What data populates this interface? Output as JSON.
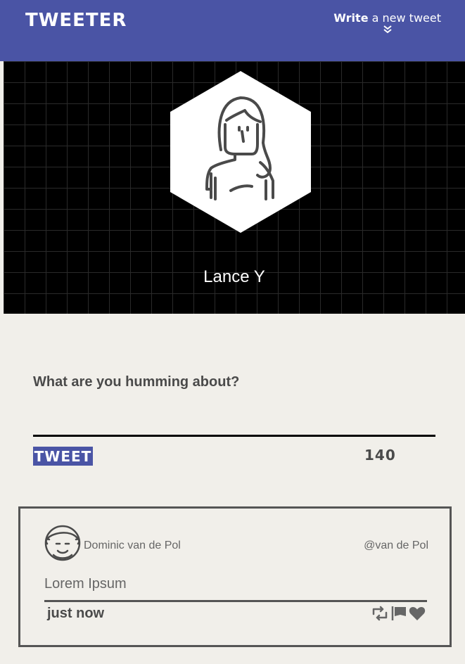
{
  "nav": {
    "brand": "TWEETER",
    "compose_bold": "Write",
    "compose_rest": " a new tweet",
    "compose_icon": "double-chevron-down-icon"
  },
  "hero": {
    "avatar_icon": "female-avatar-icon",
    "name": "Lance Y"
  },
  "composer": {
    "prompt": "What are you humming about?",
    "button_label": "TWEET",
    "counter": "140"
  },
  "feed": [
    {
      "avatar_icon": "male-avatar-icon",
      "author": "Dominic van de Pol",
      "handle": "@van de Pol",
      "content": "Lorem Ipsum",
      "time": "just now",
      "actions": [
        "retweet-icon",
        "flag-icon",
        "heart-icon"
      ]
    }
  ],
  "colors": {
    "brand": "#4a54a5",
    "background": "#f1efea",
    "text_dark": "#4a4a4a"
  }
}
